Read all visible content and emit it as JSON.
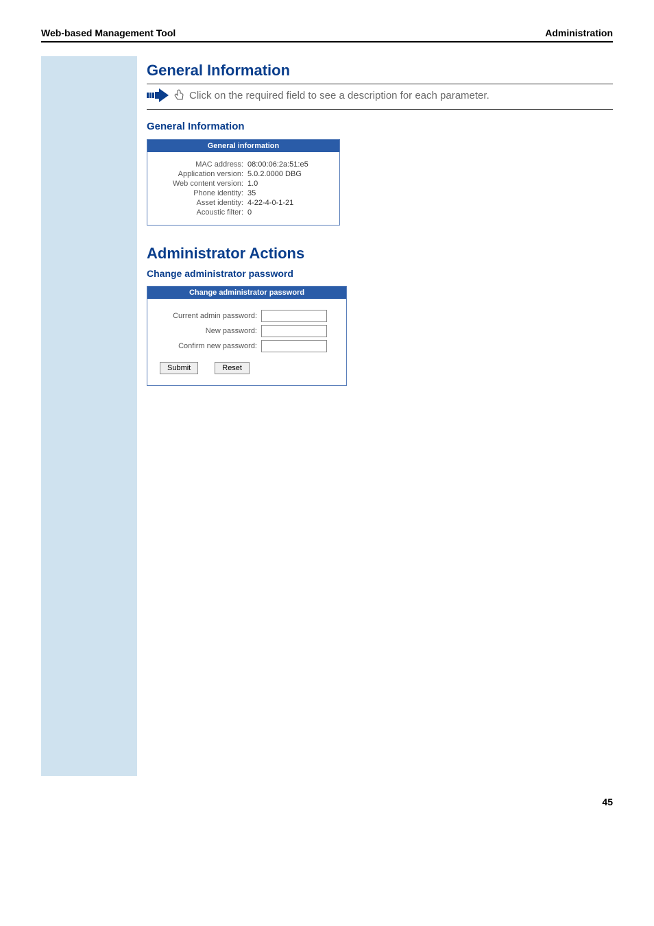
{
  "header": {
    "left": "Web-based Management Tool",
    "right": "Administration"
  },
  "section1": {
    "title": "General Information",
    "tip": "Click on the required field to see a description for each parameter.",
    "sub": "General Information",
    "panel_title": "General information",
    "rows": [
      {
        "label": "MAC address:",
        "value": "08:00:06:2a:51:e5"
      },
      {
        "label": "Application version:",
        "value": "5.0.2.0000 DBG"
      },
      {
        "label": "Web content version:",
        "value": "1.0"
      },
      {
        "label": "Phone identity:",
        "value": "35"
      },
      {
        "label": "Asset identity:",
        "value": "4-22-4-0-1-21"
      },
      {
        "label": "Acoustic filter:",
        "value": "0"
      }
    ]
  },
  "section2": {
    "title": "Administrator Actions",
    "sub": "Change administrator password",
    "panel_title": "Change administrator password",
    "fields": {
      "current": "Current admin password:",
      "new": "New password:",
      "confirm": "Confirm new password:"
    },
    "buttons": {
      "submit": "Submit",
      "reset": "Reset"
    }
  },
  "page_number": "45"
}
